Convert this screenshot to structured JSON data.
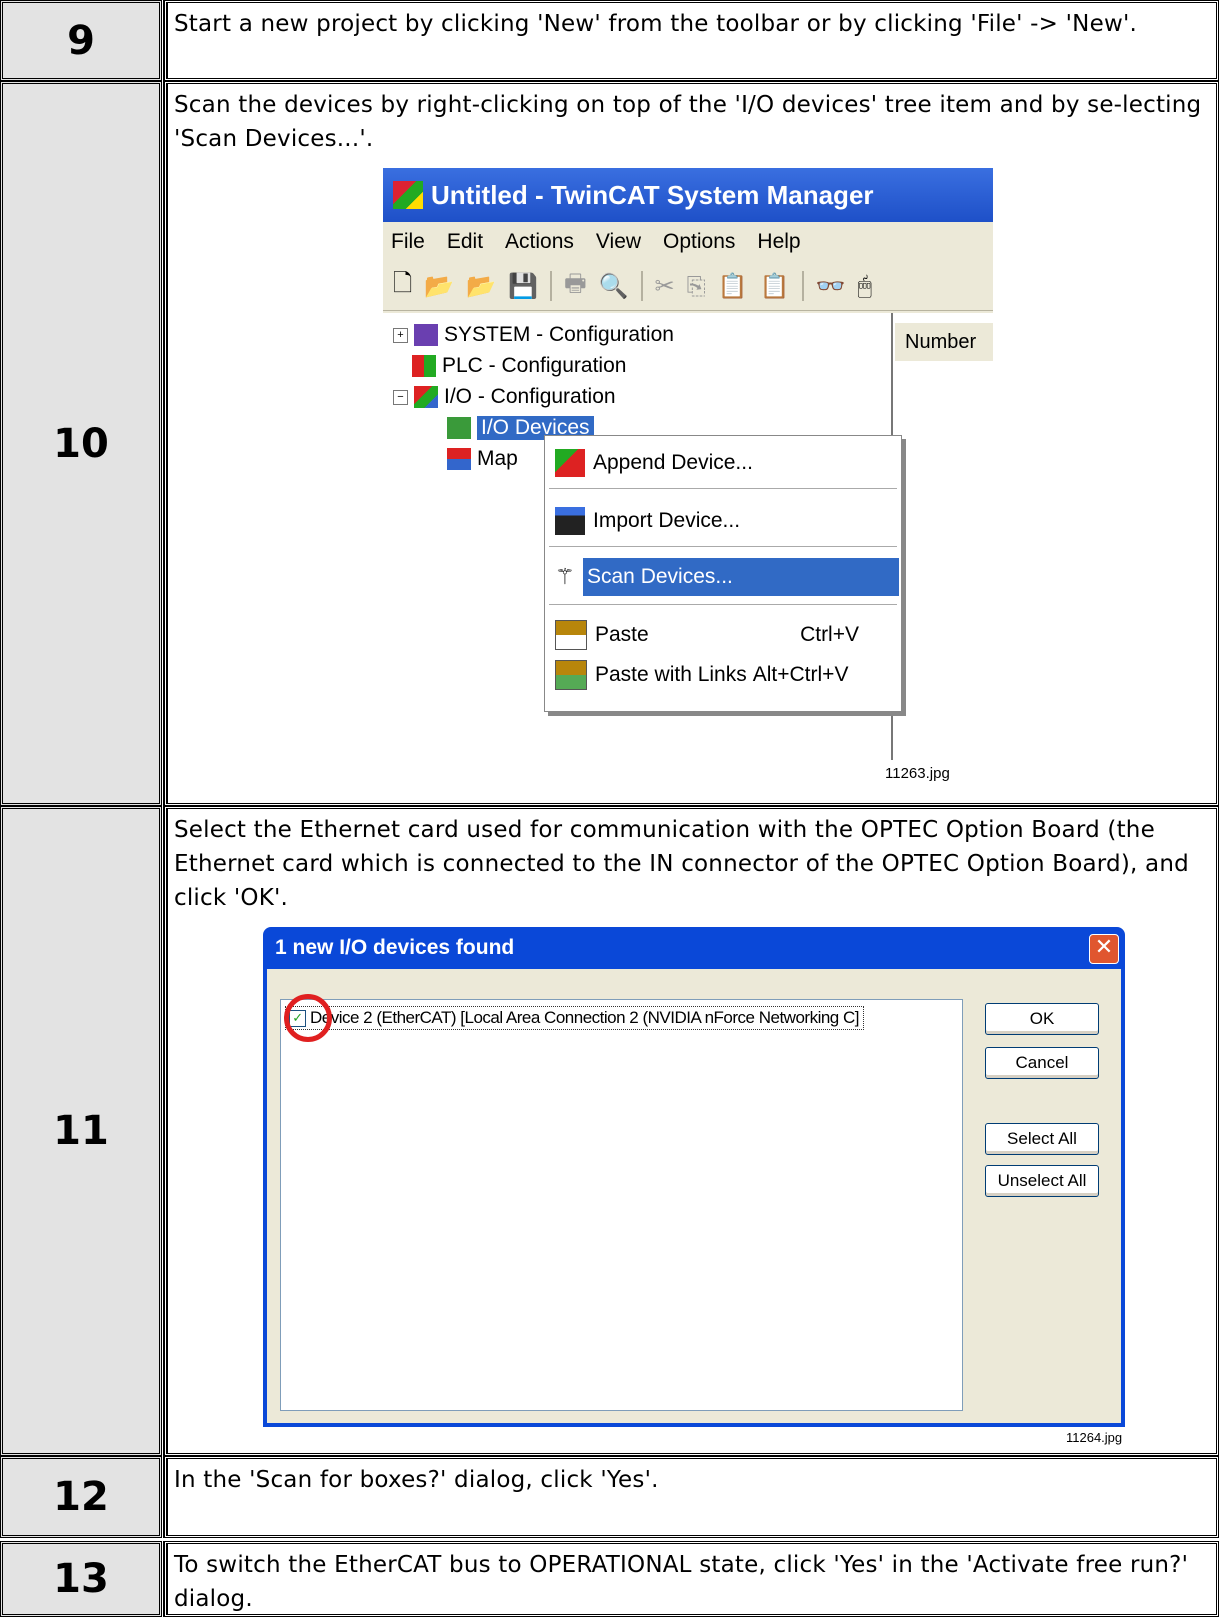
{
  "steps": [
    {
      "number": "9",
      "text": "Start a new project by clicking 'New' from the toolbar or by clicking 'File' -> 'New'."
    },
    {
      "number": "10",
      "text": "Scan the devices by right-clicking on top of the 'I/O devices' tree item and by se-lecting 'Scan Devices...'."
    },
    {
      "number": "11",
      "text": "Select the Ethernet card used for communication with the OPTEC Option Board (the Ethernet card which is connected to the IN connector of the OPTEC Option Board), and click 'OK'."
    },
    {
      "number": "12",
      "text": "In the 'Scan for boxes?' dialog, click 'Yes'."
    },
    {
      "number": "13",
      "text": " To switch the EtherCAT bus to OPERATIONAL state, click 'Yes' in the 'Activate free run?' dialog."
    }
  ],
  "screenshot1": {
    "caption": "11263.jpg",
    "window_title": "Untitled - TwinCAT System Manager",
    "menu": [
      "File",
      "Edit",
      "Actions",
      "View",
      "Options",
      "Help"
    ],
    "tree": [
      "SYSTEM - Configuration",
      "PLC - Configuration",
      "I/O - Configuration",
      "I/O Devices",
      "Map"
    ],
    "column_header": "Number",
    "context_menu": [
      {
        "label": "Append Device...",
        "shortcut": ""
      },
      {
        "label": "Import Device...",
        "shortcut": ""
      },
      {
        "label": "Scan Devices...",
        "shortcut": ""
      },
      {
        "label": "Paste",
        "shortcut": "Ctrl+V"
      },
      {
        "label": "Paste with Links",
        "shortcut": "Alt+Ctrl+V"
      }
    ]
  },
  "screenshot2": {
    "caption": "11264.jpg",
    "dialog_title": "1 new I/O devices found",
    "device_entry": "Device 2 (EtherCAT)     [Local Area Connection 2 (NVIDIA nForce Networking C]",
    "buttons": [
      "OK",
      "Cancel",
      "Select All",
      "Unselect All"
    ]
  }
}
